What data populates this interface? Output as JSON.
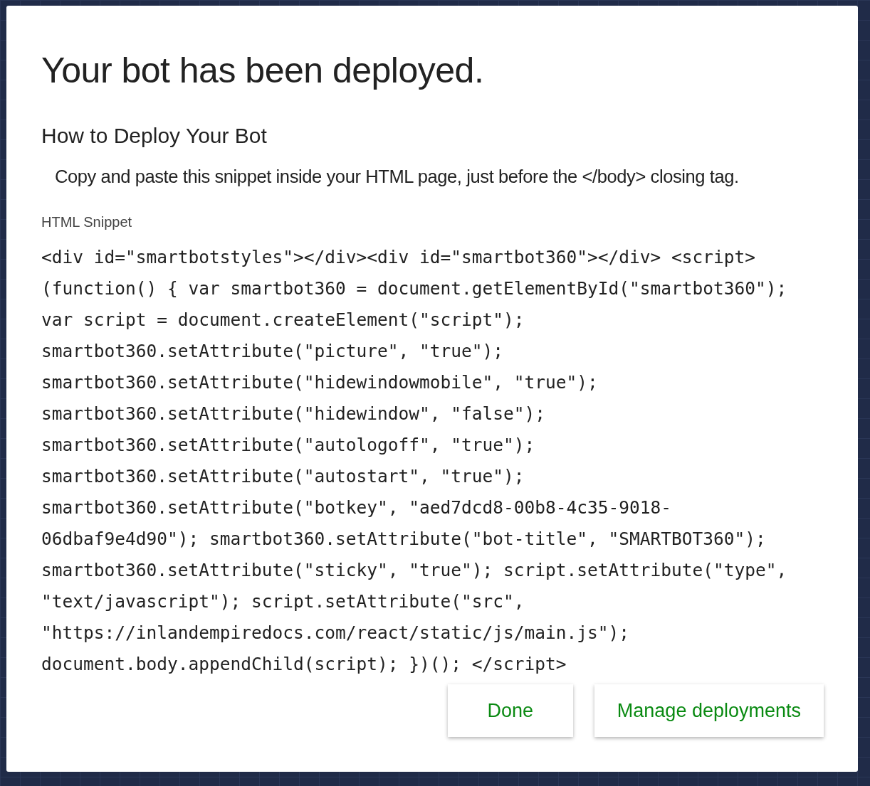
{
  "dialog": {
    "title": "Your bot has been deployed.",
    "subtitle": "How to Deploy Your Bot",
    "instructions": "Copy and paste this snippet inside your HTML page, just before the </body> closing tag.",
    "snippet_label": "HTML Snippet",
    "snippet_lines": [
      "<div id=\"smartbotstyles\"></div><div id=\"smartbot360\"></div> <script>",
      "(function() { var smartbot360 = document.getElementById(\"smartbot360\");",
      "var script = document.createElement(\"script\");",
      "smartbot360.setAttribute(\"picture\", \"true\");",
      "smartbot360.setAttribute(\"hidewindowmobile\", \"true\");",
      "smartbot360.setAttribute(\"hidewindow\", \"false\");",
      "smartbot360.setAttribute(\"autologoff\", \"true\");",
      "smartbot360.setAttribute(\"autostart\", \"true\");",
      "smartbot360.setAttribute(\"botkey\", \"aed7dcd8-00b8-4c35-9018-",
      "06dbaf9e4d90\"); smartbot360.setAttribute(\"bot-title\", \"SMARTBOT360\");",
      "smartbot360.setAttribute(\"sticky\", \"true\"); script.setAttribute(\"type\",",
      "\"text/javascript\"); script.setAttribute(\"src\",",
      "\"https://inlandempiredocs.com/react/static/js/main.js\");",
      "document.body.appendChild(script); })(); </script>"
    ],
    "buttons": [
      "Done",
      "Manage deployments"
    ]
  }
}
